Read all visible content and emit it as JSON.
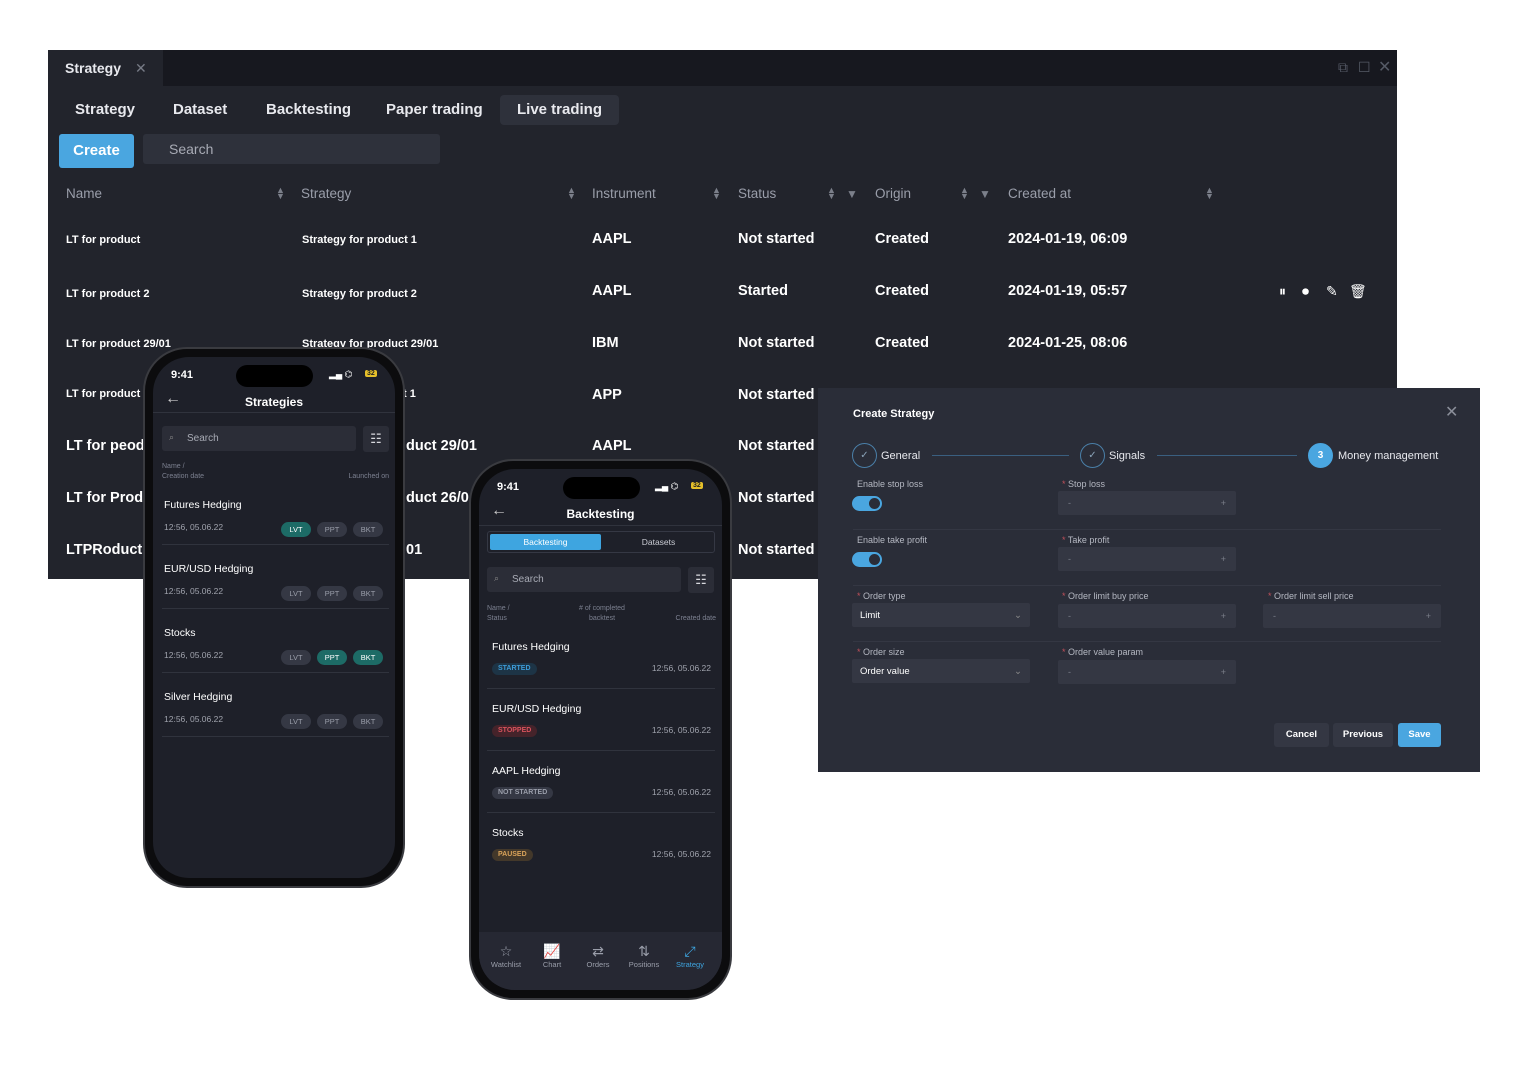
{
  "window": {
    "tab_title": "Strategy",
    "tabs": [
      "Strategy",
      "Dataset",
      "Backtesting",
      "Paper trading",
      "Live trading"
    ],
    "active_tab": "Live trading",
    "create_label": "Create",
    "search_placeholder": "Search",
    "columns": [
      "Name",
      "Strategy",
      "Instrument",
      "Status",
      "Origin",
      "Created at"
    ],
    "rows": [
      {
        "name": "LT for product",
        "strategy": "Strategy for product 1",
        "instrument": "AAPL",
        "status": "Not started",
        "origin": "Created",
        "created": "2024-01-19, 06:09"
      },
      {
        "name": "LT for product 2",
        "strategy": "Strategy for product 2",
        "instrument": "AAPL",
        "status": "Started",
        "origin": "Created",
        "created": "2024-01-19, 05:57"
      },
      {
        "name": "LT for product 29/01",
        "strategy": "Strategy for product 29/01",
        "instrument": "IBM",
        "status": "Not started",
        "origin": "Created",
        "created": "2024-01-25, 08:06"
      },
      {
        "name": "LT for product",
        "strategy": "t 1",
        "instrument": "APP",
        "status": "Not started"
      },
      {
        "name": "LT for peod",
        "strategy": "duct 29/01",
        "instrument": "AAPL",
        "status": "Not started"
      },
      {
        "name": "LT for Prod",
        "strategy": "duct 26/0",
        "status": "Not started"
      },
      {
        "name": "LTPRoduct",
        "strategy": "01",
        "status": "Not started"
      }
    ],
    "row_actions": [
      "pause-icon",
      "stop-icon",
      "edit-icon",
      "trash-icon"
    ]
  },
  "phone1": {
    "time": "9:41",
    "battery": "32",
    "title": "Strategies",
    "search_placeholder": "Search",
    "hdr_left": [
      "Name /",
      "Creation date"
    ],
    "hdr_right": "Launched on",
    "items": [
      {
        "title": "Futures Hedging",
        "date": "12:56, 05.06.22",
        "badges": [
          {
            "label": "LVT",
            "on": true
          },
          {
            "label": "PPT",
            "on": false
          },
          {
            "label": "BKT",
            "on": false
          }
        ]
      },
      {
        "title": "EUR/USD Hedging",
        "date": "12:56, 05.06.22",
        "badges": [
          {
            "label": "LVT",
            "on": false
          },
          {
            "label": "PPT",
            "on": false
          },
          {
            "label": "BKT",
            "on": false
          }
        ]
      },
      {
        "title": "Stocks",
        "date": "12:56, 05.06.22",
        "badges": [
          {
            "label": "LVT",
            "on": false
          },
          {
            "label": "PPT",
            "on": true
          },
          {
            "label": "BKT",
            "on": true
          }
        ]
      },
      {
        "title": "Silver Hedging",
        "date": "12:56, 05.06.22",
        "badges": [
          {
            "label": "LVT",
            "on": false
          },
          {
            "label": "PPT",
            "on": false
          },
          {
            "label": "BKT",
            "on": false
          }
        ]
      }
    ]
  },
  "phone2": {
    "time": "9:41",
    "battery": "32",
    "title": "Backtesting",
    "segments": [
      "Backtesting",
      "Datasets"
    ],
    "search_placeholder": "Search",
    "hdr_left": [
      "Name /",
      "Status"
    ],
    "hdr_mid": [
      "# of completed",
      "backtest"
    ],
    "hdr_right": "Created date",
    "items": [
      {
        "title": "Futures Hedging",
        "status": "STARTED",
        "date": "12:56, 05.06.22",
        "color": "#3d9bd6",
        "bg": "#1d3446"
      },
      {
        "title": "EUR/USD Hedging",
        "status": "STOPPED",
        "date": "12:56, 05.06.22",
        "color": "#d9535d",
        "bg": "#45232a"
      },
      {
        "title": "AAPL Hedging",
        "status": "NOT STARTED",
        "date": "12:56, 05.06.22",
        "color": "#9a9eaa",
        "bg": "#353844"
      },
      {
        "title": "Stocks",
        "status": "PAUSED",
        "date": "12:56, 05.06.22",
        "color": "#d9a35a",
        "bg": "#43382a"
      }
    ],
    "nav": [
      {
        "label": "Watchlist",
        "icon": "☆"
      },
      {
        "label": "Chart",
        "icon": "📈"
      },
      {
        "label": "Orders",
        "icon": "⇄"
      },
      {
        "label": "Positions",
        "icon": "⇅"
      },
      {
        "label": "Strategy",
        "icon": "⤢",
        "active": true
      }
    ]
  },
  "dialog": {
    "title": "Create Strategy",
    "steps": [
      {
        "label": "General",
        "state": "done"
      },
      {
        "label": "Signals",
        "state": "done"
      },
      {
        "label": "Money management",
        "number": "3",
        "state": "active"
      }
    ],
    "enable_stop_loss": "Enable stop loss",
    "stop_loss": "Stop loss",
    "enable_take_profit": "Enable take profit",
    "take_profit": "Take profit",
    "order_type": "Order type",
    "order_type_value": "Limit",
    "order_limit_buy": "Order limit buy price",
    "order_limit_sell": "Order limit sell price",
    "order_size": "Order size",
    "order_size_value": "Order value",
    "order_value_param": "Order value param",
    "stepper_minus": "-",
    "stepper_plus": "+",
    "stop_loss_enabled": true,
    "take_profit_enabled": true,
    "cancel": "Cancel",
    "previous": "Previous",
    "save": "Save"
  },
  "colors": {
    "accent": "#4aa6e0",
    "background": "#22242c",
    "badge_on": "#1d6b66"
  }
}
